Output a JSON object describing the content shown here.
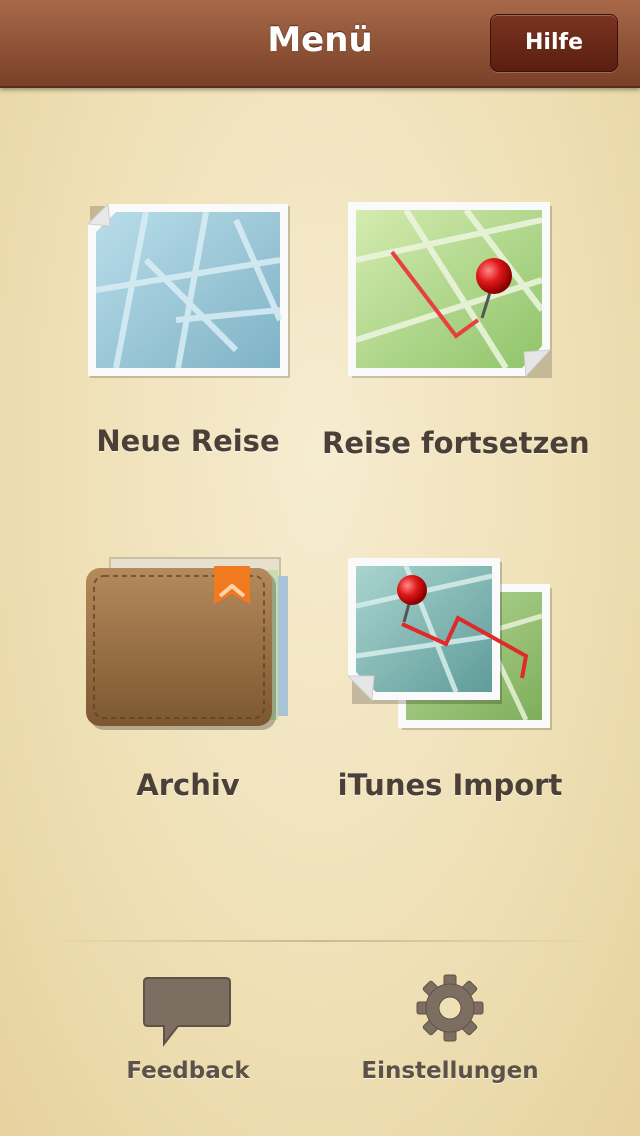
{
  "header": {
    "title": "Menü",
    "help_label": "Hilfe"
  },
  "tiles": [
    {
      "label": "Neue Reise",
      "icon": "blank-map-icon"
    },
    {
      "label": "Reise fortsetzen",
      "icon": "map-route-pin-icon"
    },
    {
      "label": "Archiv",
      "icon": "wallet-archive-icon"
    },
    {
      "label": "iTunes Import",
      "icon": "stacked-maps-icon"
    }
  ],
  "bottom": {
    "feedback_label": "Feedback",
    "settings_label": "Einstellungen"
  },
  "colors": {
    "header": "#8e5236",
    "help_button": "#6a2816",
    "background": "#efe0b6",
    "label_text": "#4a4038"
  }
}
